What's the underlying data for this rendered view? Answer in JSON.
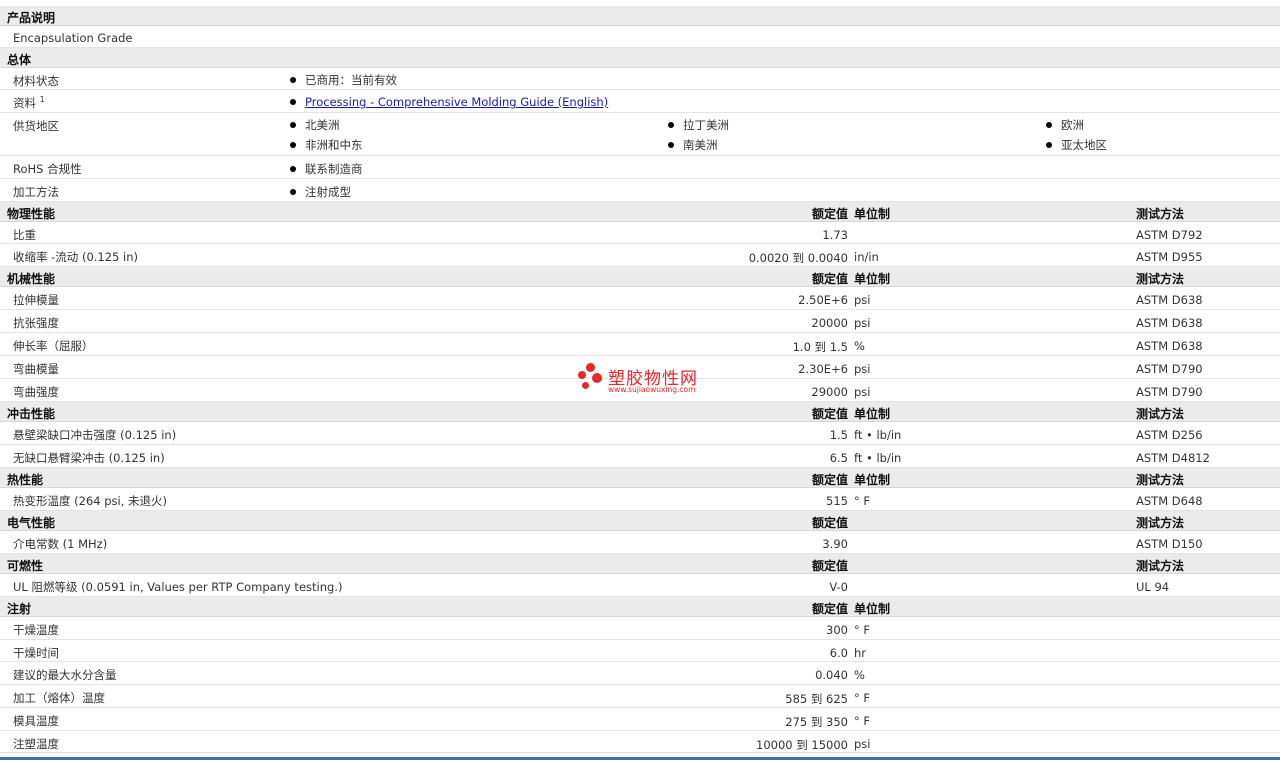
{
  "product": {
    "header": "产品说明",
    "grade": "Encapsulation Grade"
  },
  "general": {
    "header": "总体",
    "material_status_label": "材料状态",
    "material_status_value": "已商用：当前有效",
    "docs_label": "资料",
    "docs_sup": "1",
    "docs_link": "Processing - Comprehensive Molding Guide (English)",
    "supply_label": "供货地区",
    "regions": [
      "北美洲",
      "拉丁美洲",
      "欧洲",
      "非洲和中东",
      "南美洲",
      "亚太地区"
    ],
    "rohs_label": "RoHS 合规性",
    "rohs_value": "联系制造商",
    "process_label": "加工方法",
    "process_value": "注射成型"
  },
  "headers": {
    "value": "额定值",
    "unit": "单位制",
    "method": "测试方法"
  },
  "sections": [
    {
      "title": "物理性能",
      "has_unit": true,
      "has_method": true,
      "rows": [
        {
          "label": "比重",
          "value": "1.73",
          "unit": "",
          "method": "ASTM D792"
        },
        {
          "label": "收缩率 -流动 (0.125 in)",
          "value": "0.0020 到  0.0040",
          "unit": "in/in",
          "method": "ASTM D955"
        }
      ]
    },
    {
      "title": "机械性能",
      "has_unit": true,
      "has_method": true,
      "rows": [
        {
          "label": "拉伸模量",
          "value": "2.50E+6",
          "unit": "psi",
          "method": "ASTM D638"
        },
        {
          "label": "抗张强度",
          "value": "20000",
          "unit": "psi",
          "method": "ASTM D638"
        },
        {
          "label": "伸长率（屈服）",
          "value": "1.0 到  1.5",
          "unit": "%",
          "method": "ASTM D638"
        },
        {
          "label": "弯曲模量",
          "value": "2.30E+6",
          "unit": "psi",
          "method": "ASTM D790"
        },
        {
          "label": "弯曲强度",
          "value": "29000",
          "unit": "psi",
          "method": "ASTM D790"
        }
      ]
    },
    {
      "title": "冲击性能",
      "has_unit": true,
      "has_method": true,
      "rows": [
        {
          "label": "悬壁梁缺口冲击强度 (0.125 in)",
          "value": "1.5",
          "unit": "ft • lb/in",
          "method": "ASTM D256"
        },
        {
          "label": "无缺口悬臂梁冲击 (0.125 in)",
          "value": "6.5",
          "unit": "ft • lb/in",
          "method": "ASTM D4812"
        }
      ]
    },
    {
      "title": "热性能",
      "has_unit": true,
      "has_method": true,
      "rows": [
        {
          "label": "热变形温度 (264 psi, 未退火)",
          "value": "515",
          "unit": "° F",
          "method": "ASTM D648"
        }
      ]
    },
    {
      "title": "电气性能",
      "has_unit": false,
      "has_method": true,
      "rows": [
        {
          "label": "介电常数 (1 MHz)",
          "value": "3.90",
          "unit": "",
          "method": "ASTM D150"
        }
      ]
    },
    {
      "title": "可燃性",
      "has_unit": false,
      "has_method": true,
      "rows": [
        {
          "label": "UL 阻燃等级 (0.0591 in, Values per RTP Company testing.)",
          "value": "V-0",
          "unit": "",
          "method": "UL 94"
        }
      ]
    },
    {
      "title": "注射",
      "has_unit": true,
      "has_method": false,
      "rows": [
        {
          "label": "干燥温度",
          "value": "300",
          "unit": "° F",
          "method": ""
        },
        {
          "label": "干燥时间",
          "value": "6.0",
          "unit": "hr",
          "method": ""
        },
        {
          "label": "建议的最大水分含量",
          "value": "0.040",
          "unit": "%",
          "method": ""
        },
        {
          "label": "加工（熔体）温度",
          "value": "585 到  625",
          "unit": "° F",
          "method": ""
        },
        {
          "label": "模具温度",
          "value": "275 到  350",
          "unit": "° F",
          "method": ""
        },
        {
          "label": "注塑温度",
          "value": "10000 到  15000",
          "unit": "psi",
          "method": ""
        }
      ]
    }
  ],
  "watermark": {
    "text": "塑胶物性网",
    "url": "www.sujiaowuxing.com"
  },
  "colors": {
    "section_bg": "#ebebeb",
    "link": "#1a1aa6",
    "watermark": "#e8272b",
    "bottom_bar": "#3a6fb0"
  }
}
